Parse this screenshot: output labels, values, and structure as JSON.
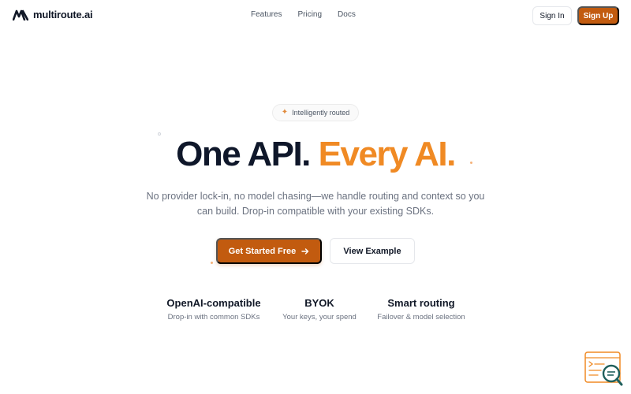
{
  "header": {
    "logo_text": "multiroute.ai",
    "nav": [
      "Features",
      "Pricing",
      "Docs"
    ],
    "signin_label": "Sign In",
    "signup_label": "Sign Up"
  },
  "hero": {
    "badge": "Intelligently routed",
    "headline_part1": "One API.",
    "headline_part2": "Every AI.",
    "subheadline": "No provider lock-in, no model chasing—we handle routing and context so you can build. Drop-in compatible with your existing SDKs.",
    "primary_cta": "Get Started Free",
    "secondary_cta": "View Example"
  },
  "features": [
    {
      "title": "OpenAI-compatible",
      "desc": "Drop-in with common SDKs"
    },
    {
      "title": "BYOK",
      "desc": "Your keys, your spend"
    },
    {
      "title": "Smart routing",
      "desc": "Failover & model selection"
    }
  ],
  "colors": {
    "brand": "#c25b0f",
    "accent_text": "#f08a24",
    "heading": "#0f172a",
    "muted": "#6b7280"
  },
  "icons": {
    "logo": "m-logo-icon",
    "badge": "sparkle-icon",
    "cta_arrow": "arrow-right-icon",
    "widget": "chat-search-icon"
  }
}
